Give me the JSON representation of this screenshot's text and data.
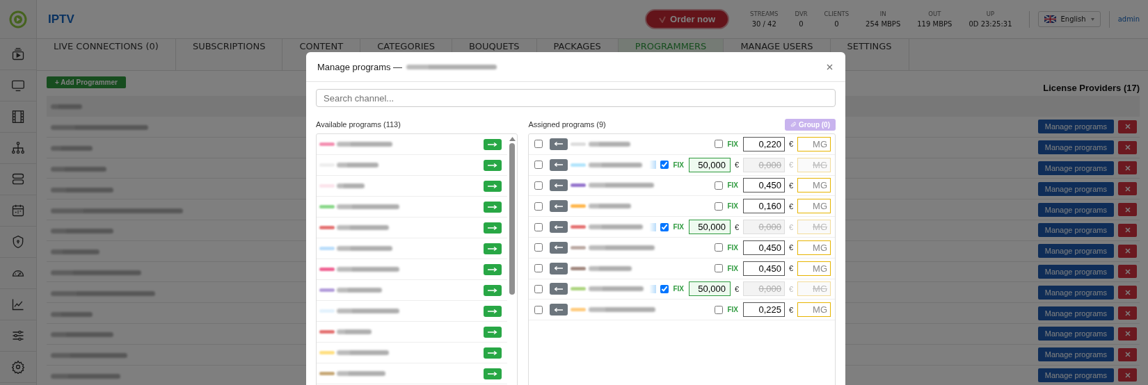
{
  "header": {
    "title": "IPTV",
    "order_button": "Order now",
    "stats": [
      {
        "label": "STREAMS",
        "value": "30 / 42"
      },
      {
        "label": "DVR",
        "value": "0"
      },
      {
        "label": "CLIENTS",
        "value": "0"
      },
      {
        "label": "IN",
        "value": "254 MBPS"
      },
      {
        "label": "OUT",
        "value": "119 MBPS"
      },
      {
        "label": "UP",
        "value": "0D 23:25:31"
      }
    ],
    "language": "English",
    "user": "admin"
  },
  "tabs": [
    {
      "label": "LIVE CONNECTIONS (0)",
      "selected": false
    },
    {
      "label": "SUBSCRIPTIONS",
      "selected": false
    },
    {
      "label": "CONTENT",
      "selected": false
    },
    {
      "label": "CATEGORIES",
      "selected": false
    },
    {
      "label": "BOUQUETS",
      "selected": false
    },
    {
      "label": "PACKAGES",
      "selected": false
    },
    {
      "label": "PROGRAMMERS",
      "selected": true
    },
    {
      "label": "MANAGE USERS",
      "selected": false
    },
    {
      "label": "SETTINGS",
      "selected": false
    }
  ],
  "providers": {
    "add_button": "+ Add Programmer",
    "title": "License Providers (17)",
    "rows": [
      {
        "action": "Manage programs"
      },
      {
        "action": "Manage programs"
      },
      {
        "action": "Manage programs"
      },
      {
        "action": "Manage programs"
      },
      {
        "action": "Manage programs"
      },
      {
        "action": "Manage programs"
      },
      {
        "action": "Manage programs"
      },
      {
        "action": "Manage programs"
      },
      {
        "action": "Manage programs"
      },
      {
        "action": "Manage programs"
      },
      {
        "action": "Manage programs"
      },
      {
        "action": "Manage programs"
      },
      {
        "action": "Manage programs"
      }
    ]
  },
  "modal": {
    "title": "Manage programs —",
    "search": {
      "placeholder": "Search channel..."
    },
    "available": {
      "title": "Available programs (113)",
      "items": [
        {
          "color": "#f48fb1"
        },
        {
          "color": "#eeeeee"
        },
        {
          "color": "#fce4ec"
        },
        {
          "color": "#8bd88b"
        },
        {
          "color": "#e57373"
        },
        {
          "color": "#bbdefb"
        },
        {
          "color": "#f06292"
        },
        {
          "color": "#b39ddb"
        },
        {
          "color": "#e3f2fd"
        },
        {
          "color": "#e57373"
        },
        {
          "color": "#ffe082"
        },
        {
          "color": "#c8a978"
        }
      ]
    },
    "assigned": {
      "title": "Assigned programs (9)",
      "group_button": "Group (0)",
      "rows": [
        {
          "checked": false,
          "color": "#dddddd",
          "fix": false,
          "fix_label": "FIX",
          "price": "0,220",
          "currency": "€",
          "mg_placeholder": "MG"
        },
        {
          "checked": false,
          "color": "#b3e5fc",
          "fix": true,
          "fix_label": "FIX",
          "price": "50,000",
          "currency": "€",
          "base_price": "0,000",
          "base_currency": "€",
          "mg_placeholder": "MG"
        },
        {
          "checked": false,
          "color": "#9575cd",
          "fix": false,
          "fix_label": "FIX",
          "price": "0,450",
          "currency": "€",
          "mg_placeholder": "MG"
        },
        {
          "checked": false,
          "color": "#ffb74d",
          "fix": false,
          "fix_label": "FIX",
          "price": "0,160",
          "currency": "€",
          "mg_placeholder": "MG"
        },
        {
          "checked": false,
          "color": "#e57373",
          "fix": true,
          "fix_label": "FIX",
          "price": "50,000",
          "currency": "€",
          "base_price": "0,000",
          "base_currency": "€",
          "mg_placeholder": "MG"
        },
        {
          "checked": false,
          "color": "#bcaaa4",
          "fix": false,
          "fix_label": "FIX",
          "price": "0,450",
          "currency": "€",
          "mg_placeholder": "MG"
        },
        {
          "checked": false,
          "color": "#a1887f",
          "fix": false,
          "fix_label": "FIX",
          "price": "0,450",
          "currency": "€",
          "mg_placeholder": "MG"
        },
        {
          "checked": false,
          "color": "#aed581",
          "fix": true,
          "fix_label": "FIX",
          "price": "50,000",
          "currency": "€",
          "base_price": "0,000",
          "base_currency": "€",
          "mg_placeholder": "MG"
        },
        {
          "checked": false,
          "color": "#ffcc80",
          "fix": false,
          "fix_label": "FIX",
          "price": "0,225",
          "currency": "€",
          "mg_placeholder": "MG"
        }
      ]
    }
  }
}
